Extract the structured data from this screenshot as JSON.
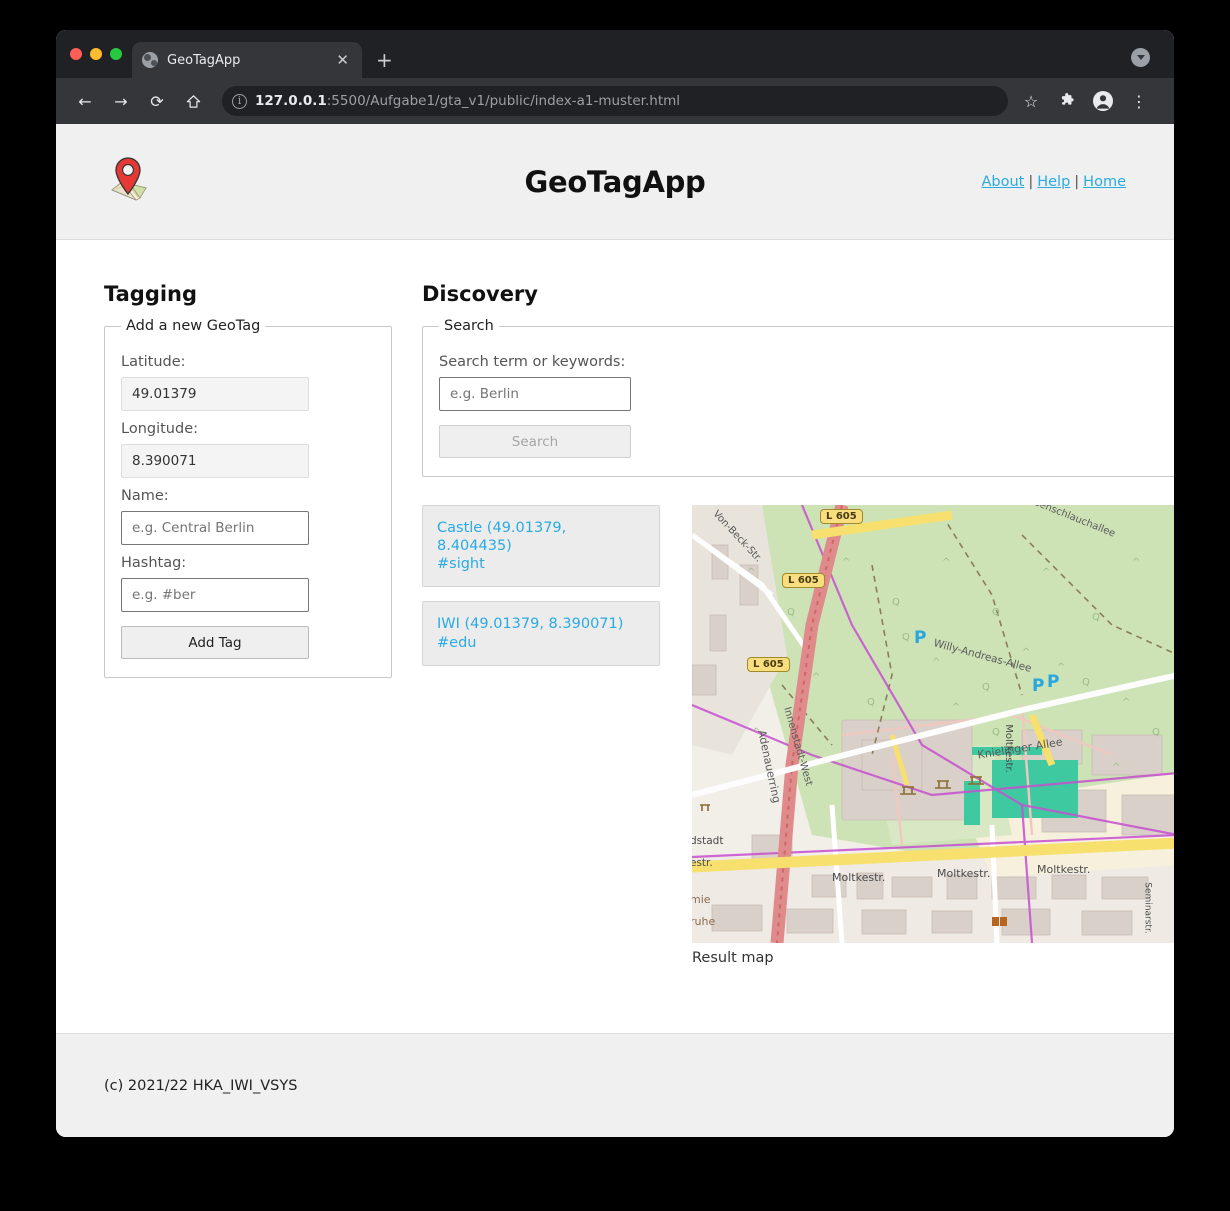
{
  "browser": {
    "tab": {
      "title": "GeoTagApp",
      "favicon": "globe-icon",
      "close": "✕"
    },
    "new_tab": "+",
    "toolbar": {
      "back": "←",
      "forward": "→",
      "reload": "⟳",
      "home": "⌂",
      "url_bold": "127.0.0.1",
      "url_rest": ":5500/Aufgabe1/gta_v1/public/index-a1-muster.html",
      "bookmark": "☆",
      "extensions": "puzzle-icon",
      "profile": "avatar-icon",
      "menu": "⋮"
    }
  },
  "header": {
    "title": "GeoTagApp",
    "logo": "map-pin-logo",
    "nav": [
      {
        "label": "About"
      },
      {
        "label": "Help"
      },
      {
        "label": "Home"
      }
    ],
    "separator": "|"
  },
  "tagging": {
    "heading": "Tagging",
    "legend": "Add a new GeoTag",
    "fields": [
      {
        "label": "Latitude:",
        "value": "49.01379",
        "placeholder": "",
        "readonly": true
      },
      {
        "label": "Longitude:",
        "value": "8.390071",
        "placeholder": "",
        "readonly": true
      },
      {
        "label": "Name:",
        "value": "",
        "placeholder": "e.g. Central Berlin",
        "readonly": false
      },
      {
        "label": "Hashtag:",
        "value": "",
        "placeholder": "e.g. #ber",
        "readonly": false
      }
    ],
    "submit_label": "Add Tag"
  },
  "discovery": {
    "heading": "Discovery",
    "legend": "Search",
    "search_label": "Search term or keywords:",
    "search_value": "",
    "search_placeholder": "e.g. Berlin",
    "search_button": "Search",
    "search_button_disabled": true,
    "results": [
      {
        "line1": "Castle (49.01379, 8.404435)",
        "line2": "#sight"
      },
      {
        "line1": "IWI (49.01379, 8.390071)",
        "line2": "#edu"
      }
    ],
    "map_caption": "Result map",
    "map": {
      "shields": [
        "L 605",
        "L 605",
        "L 605"
      ],
      "street_labels": [
        "Von-Beck-Str.",
        "Adenauerring",
        "Innenstadt-West",
        "Willy-Andreas-Allee",
        "Knielinger Allee",
        "Moltkestr.",
        "Moltkestr.",
        "Moltkestr.",
        "senschlauchallee",
        "Moltkestr.",
        "Seminarstr.",
        "dstadt",
        "estr.",
        "mie",
        "ruhe"
      ],
      "poi_markers": [
        "P",
        "P",
        "P"
      ]
    }
  },
  "footer": {
    "text": "(c) 2021/22 HKA_IWI_VSYS"
  },
  "colors": {
    "link": "#29abe2",
    "header_bg": "#f0f0f0",
    "result_bg": "#ececec",
    "browser_dark": "#202124"
  }
}
